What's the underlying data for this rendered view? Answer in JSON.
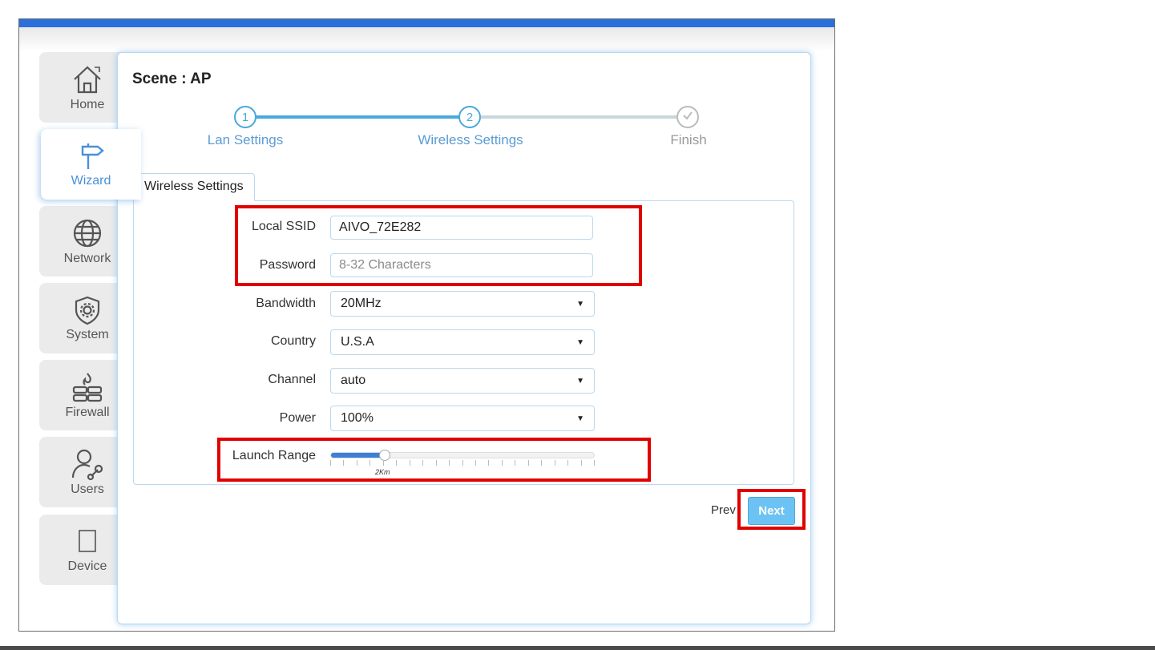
{
  "sidebar": {
    "items": [
      {
        "label": "Home",
        "icon": "home-icon"
      },
      {
        "label": "Wizard",
        "icon": "signpost-icon",
        "active": true
      },
      {
        "label": "Network",
        "icon": "globe-icon"
      },
      {
        "label": "System",
        "icon": "gear-shield-icon"
      },
      {
        "label": "Firewall",
        "icon": "firewall-icon"
      },
      {
        "label": "Users",
        "icon": "user-wrench-icon"
      },
      {
        "label": "Device",
        "icon": "device-icon"
      }
    ]
  },
  "scene": {
    "title": "Scene : AP"
  },
  "steps": [
    {
      "number": "1",
      "label": "Lan Settings"
    },
    {
      "number": "2",
      "label": "Wireless Settings"
    },
    {
      "number": "",
      "label": "Finish"
    }
  ],
  "form": {
    "tab_label": "Wireless Settings",
    "ssid": {
      "label": "Local SSID",
      "value": "AIVO_72E282"
    },
    "password": {
      "label": "Password",
      "placeholder": "8-32 Characters"
    },
    "bandwidth": {
      "label": "Bandwidth",
      "value": "20MHz"
    },
    "country": {
      "label": "Country",
      "value": "U.S.A"
    },
    "channel": {
      "label": "Channel",
      "value": "auto"
    },
    "power": {
      "label": "Power",
      "value": "100%"
    },
    "launch_range": {
      "label": "Launch Range",
      "value_label": "2Km",
      "fraction": 0.2
    }
  },
  "buttons": {
    "prev": "Prev",
    "next": "Next"
  },
  "colors": {
    "accent": "#4aa8dc",
    "topbar": "#2a6fdb",
    "next": "#6cc3f3",
    "highlight": "#e00000"
  }
}
